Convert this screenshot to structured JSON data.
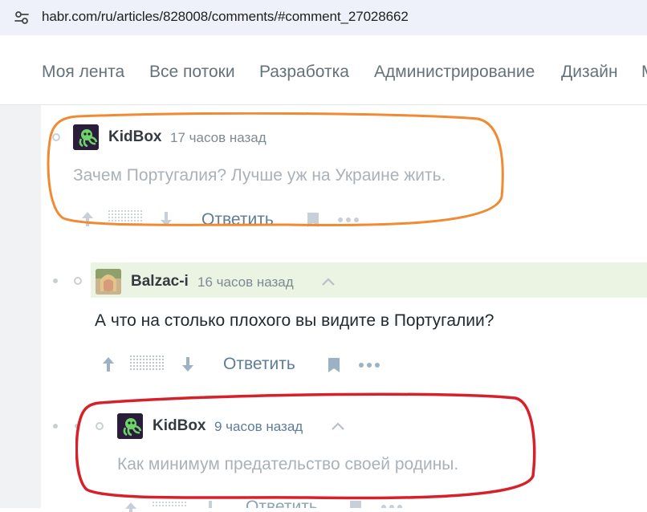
{
  "browser": {
    "url": "habr.com/ru/articles/828008/comments/#comment_27028662"
  },
  "nav": {
    "items": [
      "Моя лента",
      "Все потоки",
      "Разработка",
      "Администрирование",
      "Дизайн",
      "М"
    ]
  },
  "comments": [
    {
      "username": "KidBox",
      "time": "17 часов назад",
      "text": "Зачем Португалия? Лучше уж на Украине жить.",
      "reply_label": "Ответить"
    },
    {
      "username": "Balzac-i",
      "time": "16 часов назад",
      "text": "А что на столько плохого вы видите в Португалии?",
      "reply_label": "Ответить"
    },
    {
      "username": "KidBox",
      "time": "9 часов назад",
      "text": "Как минимум предательство своей родины.",
      "reply_label": "Ответить"
    }
  ],
  "colors": {
    "orange_highlight": "#f08a33",
    "red_highlight": "#d6212a",
    "link": "#5e7d96",
    "faded_text": "#a9b2b8"
  }
}
